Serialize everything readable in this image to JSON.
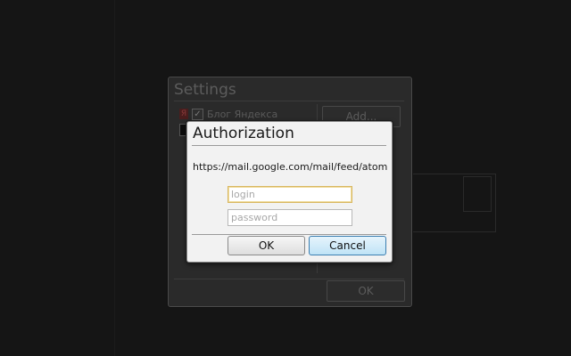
{
  "settings_window": {
    "title": "Settings",
    "feeds": [
      {
        "label": "Блог Яндекса",
        "checked": true,
        "icon": "yandex-icon"
      },
      {
        "label": "",
        "checked": false,
        "icon": "feed-icon"
      }
    ],
    "add_label": "Add...",
    "ok_label": "OK"
  },
  "auth_dialog": {
    "title": "Authorization",
    "url": "https://mail.google.com/mail/feed/atom",
    "login": {
      "value": "",
      "placeholder": "login"
    },
    "password": {
      "value": "",
      "placeholder": "password"
    },
    "ok_label": "OK",
    "cancel_label": "Cancel"
  },
  "colors": {
    "background": "#151515",
    "dialog_bg": "#f2f2f2",
    "focus_border": "#d8b760",
    "default_button": "#bfe3f6"
  }
}
